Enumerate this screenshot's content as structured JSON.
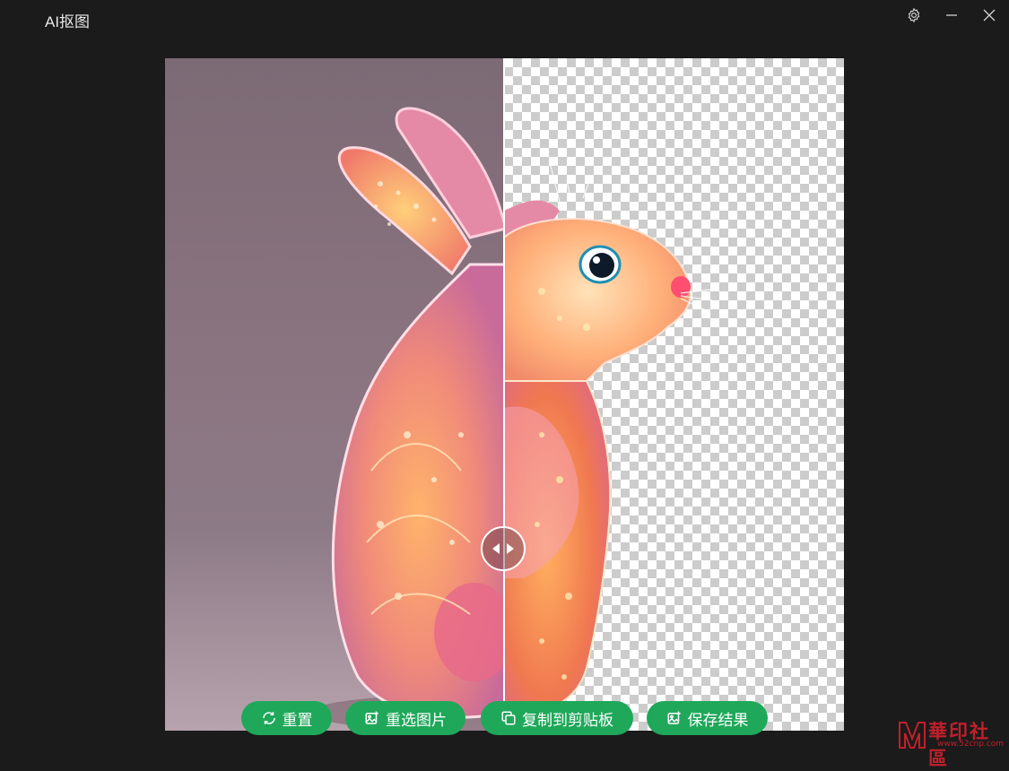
{
  "window": {
    "title": "AI抠图",
    "controls": [
      "gear-icon",
      "minimize-icon",
      "close-icon"
    ]
  },
  "compare": {
    "split": 0.5,
    "left_label": "",
    "right_label": ""
  },
  "actions": {
    "reset_label": "重置",
    "reselect_label": "重选图片",
    "copy_label": "复制到剪贴板",
    "save_label": "保存结果"
  },
  "watermark": {
    "text": "華印社區",
    "url": "www.52cnp.com"
  },
  "colors": {
    "accent": "#1fa85a",
    "background": "#1b1b1b",
    "watermark": "#c0202a"
  }
}
